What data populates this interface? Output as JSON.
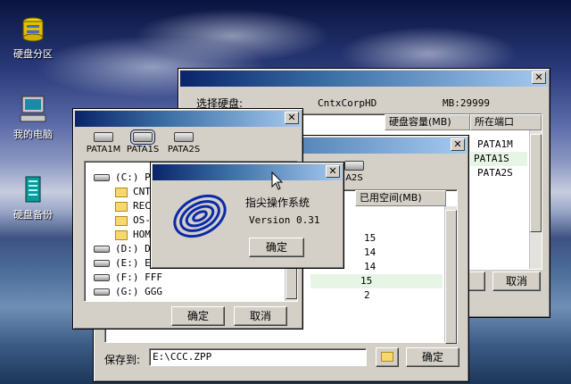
{
  "desktop": {
    "icons": [
      {
        "label": "硬盘分区"
      },
      {
        "label": "我的电脑"
      },
      {
        "label": "硬盘备份"
      }
    ]
  },
  "main_window": {
    "select_disk_label": "选择硬盘:",
    "disk_name": "CntxCorpHD",
    "disk_size": "MB:29999",
    "columns": [
      "硬盘容量(MB)",
      "所在端口"
    ],
    "ports": [
      "PATA1M",
      "PATA1S",
      "PATA2S"
    ],
    "buttons": {
      "cancel": "取消"
    }
  },
  "mid_window": {
    "tab_label": "A2S",
    "columns": [
      "已用空间(MB)"
    ],
    "used": [
      "15",
      "14",
      "14",
      "15",
      "2"
    ],
    "save_label": "保存到:",
    "save_path": "E:\\CCC.ZPP",
    "buttons": {
      "ok": "确定"
    }
  },
  "tree_window": {
    "drives": [
      "PATA1M",
      "PATA1S",
      "PATA2S"
    ],
    "tree": [
      {
        "label": "(C:) PL"
      },
      {
        "label": "CNT"
      },
      {
        "label": "REC"
      },
      {
        "label": "OS-"
      },
      {
        "label": "HOM"
      },
      {
        "label": "(D:) DD"
      },
      {
        "label": "(E:) EE"
      },
      {
        "label": "(F:) FFF"
      },
      {
        "label": "(G:) GGG"
      }
    ],
    "buttons": {
      "ok": "确定",
      "cancel": "取消"
    }
  },
  "about_dialog": {
    "title": "指尖操作系统",
    "version": "Version 0.31",
    "ok": "确定"
  },
  "colors": {
    "title_gradient_start": "#0a246a",
    "title_gradient_end": "#a6caf0",
    "face": "#d4d0c8",
    "highlight_row": "#e6f5e6"
  }
}
